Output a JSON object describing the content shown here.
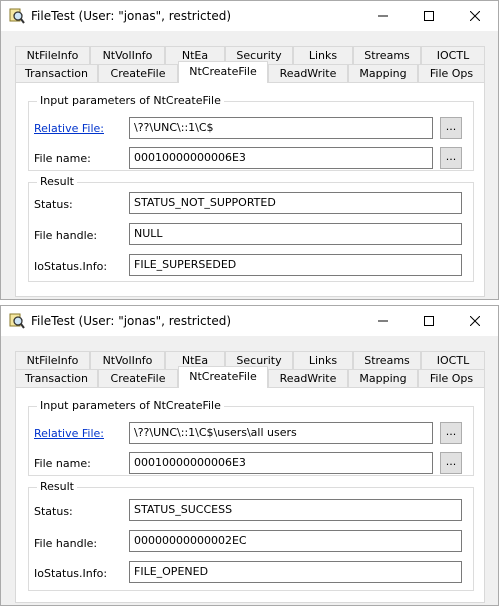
{
  "windows": [
    {
      "title": "FileTest (User: \"jonas\", restricted)",
      "tabs_row1": [
        "NtFileInfo",
        "NtVolInfo",
        "NtEa",
        "Security",
        "Links",
        "Streams",
        "IOCTL"
      ],
      "tabs_row2": [
        "Transaction",
        "CreateFile",
        "NtCreateFile",
        "ReadWrite",
        "Mapping",
        "File Ops"
      ],
      "active_tab": "NtCreateFile",
      "input_group_title": "Input parameters of NtCreateFile",
      "relative_file_label": "Relative File:",
      "relative_file_value": "\\??\\UNC\\::1\\C$",
      "file_name_label": "File name:",
      "file_name_value": "00010000000006E3",
      "browse_label": "...",
      "result_group_title": "Result",
      "status_label": "Status:",
      "status_value": "STATUS_NOT_SUPPORTED",
      "file_handle_label": "File handle:",
      "file_handle_value": "NULL",
      "iostatus_label": "IoStatus.Info:",
      "iostatus_value": "FILE_SUPERSEDED"
    },
    {
      "title": "FileTest (User: \"jonas\", restricted)",
      "tabs_row1": [
        "NtFileInfo",
        "NtVolInfo",
        "NtEa",
        "Security",
        "Links",
        "Streams",
        "IOCTL"
      ],
      "tabs_row2": [
        "Transaction",
        "CreateFile",
        "NtCreateFile",
        "ReadWrite",
        "Mapping",
        "File Ops"
      ],
      "active_tab": "NtCreateFile",
      "input_group_title": "Input parameters of NtCreateFile",
      "relative_file_label": "Relative File:",
      "relative_file_value": "\\??\\UNC\\::1\\C$\\users\\all users",
      "file_name_label": "File name:",
      "file_name_value": "00010000000006E3",
      "browse_label": "...",
      "result_group_title": "Result",
      "status_label": "Status:",
      "status_value": "STATUS_SUCCESS",
      "file_handle_label": "File handle:",
      "file_handle_value": "00000000000002EC",
      "iostatus_label": "IoStatus.Info:",
      "iostatus_value": "FILE_OPENED"
    }
  ]
}
